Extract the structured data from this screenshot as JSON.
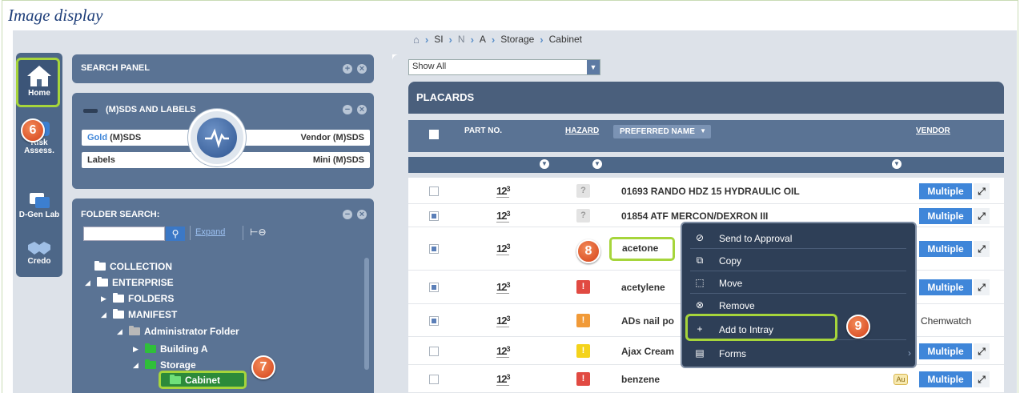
{
  "caption": "Image display",
  "breadcrumb": {
    "items": [
      "SI",
      "N",
      "A",
      "Storage",
      "Cabinet"
    ]
  },
  "leftnav": {
    "items": [
      {
        "label": "Home",
        "icon": "home-icon"
      },
      {
        "label": "Risk Assess.",
        "icon": "risk-assess-icon"
      },
      {
        "label": "D-Gen Lab",
        "icon": "dgen-lab-icon"
      },
      {
        "label": "Credo",
        "icon": "handshake-icon"
      }
    ]
  },
  "search_panel": {
    "title": "SEARCH PANEL"
  },
  "sds_panel": {
    "title": "(M)SDS AND LABELS",
    "gold_prefix": "Gold",
    "gold_suffix": "(M)SDS",
    "vendor": "Vendor (M)SDS",
    "labels": "Labels",
    "mini": "Mini (M)SDS"
  },
  "folder_search": {
    "title": "FOLDER SEARCH:",
    "input_value": "",
    "expand_label": "Expand",
    "tree": [
      "COLLECTION",
      "ENTERPRISE",
      "FOLDERS",
      "MANIFEST",
      "Administrator Folder",
      "Building A",
      "Storage",
      "Cabinet"
    ]
  },
  "filter": {
    "selected": "Show All"
  },
  "table": {
    "title": "PLACARDS",
    "headers": {
      "part_no": "PART NO.",
      "hazard": "HAZARD",
      "preferred_name": "PREFERRED NAME",
      "vendor": "VENDOR"
    },
    "rows": [
      {
        "checked": false,
        "hazard": "?",
        "hazard_color": "grey",
        "name": "01693 RANDO HDZ 15 HYDRAULIC OIL",
        "vendor": "Multiple"
      },
      {
        "checked": true,
        "hazard": "?",
        "hazard_color": "grey",
        "name": "01854 ATF MERCON/DEXRON III",
        "vendor": "Multiple"
      },
      {
        "checked": true,
        "hazard": "",
        "hazard_color": "none",
        "name": "acetone",
        "vendor": "Multiple"
      },
      {
        "checked": true,
        "hazard": "!",
        "hazard_color": "#e14a42",
        "name": "acetylene",
        "vendor": "Multiple"
      },
      {
        "checked": true,
        "hazard": "!",
        "hazard_color": "#f19a38",
        "name": "ADs nail po",
        "vendor": "Chemwatch"
      },
      {
        "checked": false,
        "hazard": "!",
        "hazard_color": "#f4d31b",
        "name": "Ajax Cream",
        "vendor": "Multiple"
      },
      {
        "checked": false,
        "hazard": "!",
        "hazard_color": "#e14a42",
        "name": "benzene",
        "vendor": "Multiple",
        "tag": "Au"
      }
    ],
    "part_no_icon": "123"
  },
  "context_menu": {
    "items": [
      "Send to Approval",
      "Copy",
      "Move",
      "Remove",
      "Add to Intray",
      "Forms"
    ]
  },
  "callouts": [
    "6",
    "7",
    "8",
    "9"
  ],
  "colors": {
    "highlight": "#a6d53b",
    "callout": "#e05a28",
    "nav": "#4d6788",
    "vendor_button": "#3f86d9"
  }
}
